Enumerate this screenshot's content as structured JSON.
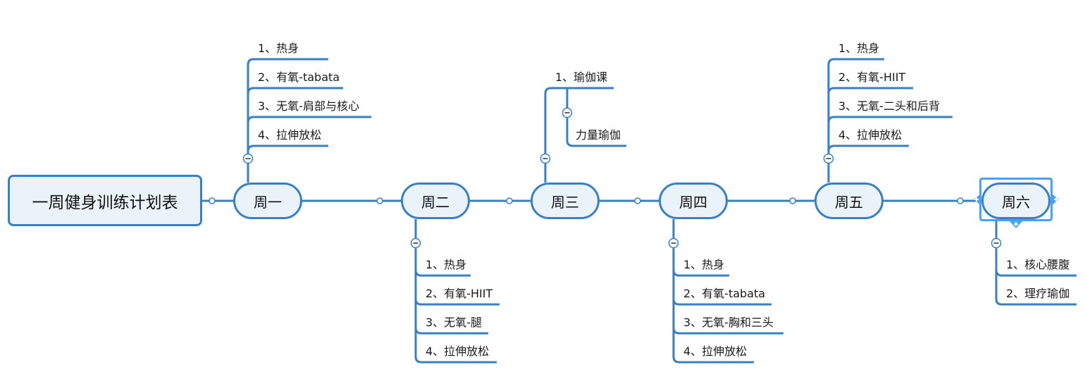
{
  "title": "一周健身训练计划表",
  "colors": {
    "line": "#3a7fbf",
    "node_fill": "#eaf2fa",
    "selection": "#4aa0f5"
  },
  "days": [
    {
      "label": "周一",
      "position": "above",
      "items": [
        "1、热身",
        "2、有氧-tabata",
        "3、无氧-肩部与核心",
        "4、拉伸放松"
      ]
    },
    {
      "label": "周二",
      "position": "below",
      "items": [
        "1、热身",
        "2、有氧-HIIT",
        "3、无氧-腿",
        "4、拉伸放松"
      ]
    },
    {
      "label": "周三",
      "position": "above",
      "items": [
        "1、瑜伽课"
      ],
      "subitems": [
        "力量瑜伽"
      ]
    },
    {
      "label": "周四",
      "position": "below",
      "items": [
        "1、热身",
        "2、有氧-tabata",
        "3、无氧-胸和三头",
        "4、拉伸放松"
      ]
    },
    {
      "label": "周五",
      "position": "above",
      "items": [
        "1、热身",
        "2、有氧-HIIT",
        "3、无氧-二头和后背",
        "4、拉伸放松"
      ]
    },
    {
      "label": "周六",
      "position": "below",
      "selected": true,
      "items": [
        "1、核心腰腹",
        "2、理疗瑜伽"
      ]
    }
  ],
  "icons": {
    "collapse": "minus-circle-icon",
    "connector": "connector-dot-icon",
    "add": "plus-handle-icon"
  }
}
